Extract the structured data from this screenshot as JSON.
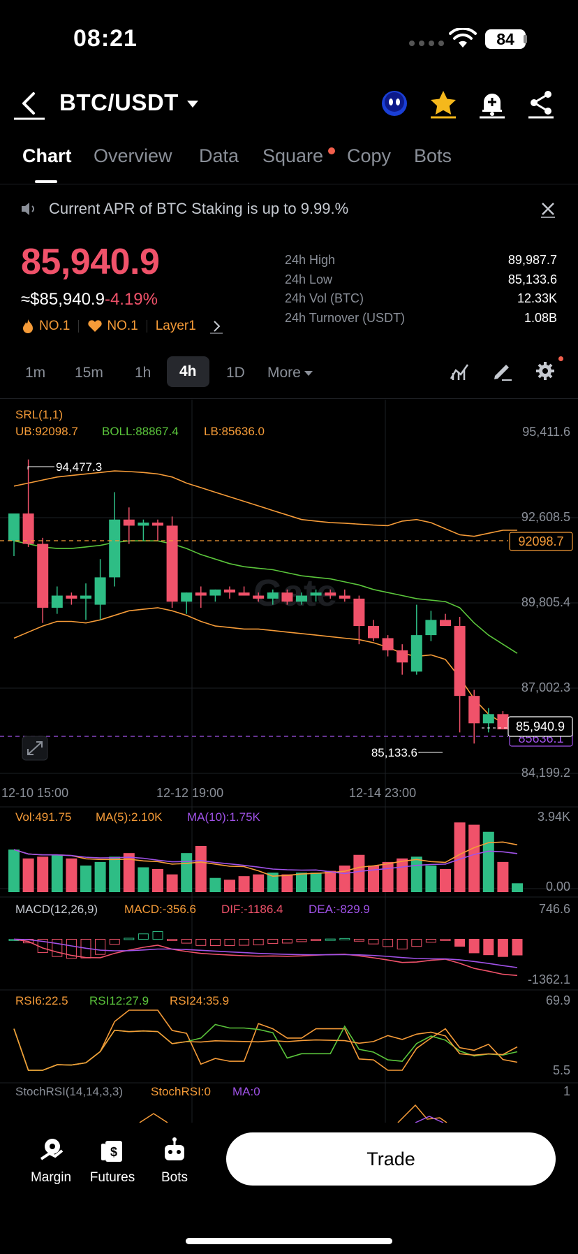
{
  "status": {
    "time": "08:21",
    "battery": "84"
  },
  "header": {
    "pair": "BTC/USDT"
  },
  "tabs": [
    "Chart",
    "Overview",
    "Data",
    "Square",
    "Copy",
    "Bots"
  ],
  "announcement": "Current APR of BTC Staking is up to 9.99.%",
  "price": {
    "last": "85,940.9",
    "usd": "≈$85,940.9",
    "change": "-4.19%",
    "rank1": "NO.1",
    "rank2": "NO.1",
    "tag": "Layer1"
  },
  "stats": [
    {
      "label": "24h High",
      "value": "89,987.7"
    },
    {
      "label": "24h Low",
      "value": "85,133.6"
    },
    {
      "label": "24h Vol (BTC)",
      "value": "12.33K"
    },
    {
      "label": "24h Turnover (USDT)",
      "value": "1.08B"
    }
  ],
  "intervals": {
    "items": [
      "1m",
      "15m",
      "1h",
      "4h",
      "1D"
    ],
    "more": "More",
    "active": "4h"
  },
  "colors": {
    "up": "#2ebd85",
    "down": "#f0526a",
    "upper_band": "#f59b38",
    "mid_band": "#5ac43b",
    "accent": "#f0526a"
  },
  "chart_data": {
    "type": "candlestick",
    "srl_label": "SRL(1,1)",
    "boll": {
      "ub_text": "UB:92098.7",
      "boll_text": "BOLL:88867.4",
      "lb_text": "LB:85636.0"
    },
    "y_ticks": [
      "95,411.6",
      "92,608.5",
      "89,805.4",
      "87,002.3",
      "84,199.2"
    ],
    "x_ticks": [
      "12-10 15:00",
      "12-12 19:00",
      "12-14 23:00"
    ],
    "price_tag_ub": "92098.7",
    "price_tag_last": "85,940.9",
    "price_tag_lb": "85636.1",
    "marker_high": "94,477.3",
    "marker_low": "85,133.6",
    "watermark": "Gate",
    "ylim": [
      84199.2,
      95411.6
    ],
    "candles": [
      {
        "o": 91800,
        "h": 92600,
        "l": 91300,
        "c": 92700
      },
      {
        "o": 92700,
        "h": 94477,
        "l": 91600,
        "c": 91700
      },
      {
        "o": 91700,
        "h": 91900,
        "l": 89100,
        "c": 89600
      },
      {
        "o": 89600,
        "h": 90300,
        "l": 89400,
        "c": 90000
      },
      {
        "o": 90000,
        "h": 90100,
        "l": 89700,
        "c": 89900
      },
      {
        "o": 89900,
        "h": 90400,
        "l": 89200,
        "c": 90000
      },
      {
        "o": 89700,
        "h": 91200,
        "l": 89200,
        "c": 90600
      },
      {
        "o": 90600,
        "h": 93400,
        "l": 90300,
        "c": 92500
      },
      {
        "o": 92500,
        "h": 92900,
        "l": 91700,
        "c": 92300
      },
      {
        "o": 92300,
        "h": 92500,
        "l": 91800,
        "c": 92400
      },
      {
        "o": 92400,
        "h": 92500,
        "l": 91800,
        "c": 92300
      },
      {
        "o": 92300,
        "h": 92600,
        "l": 89600,
        "c": 89800
      },
      {
        "o": 89800,
        "h": 90100,
        "l": 89400,
        "c": 90100
      },
      {
        "o": 90100,
        "h": 90300,
        "l": 89600,
        "c": 90000
      },
      {
        "o": 90000,
        "h": 90200,
        "l": 89800,
        "c": 90200
      },
      {
        "o": 90200,
        "h": 90300,
        "l": 89900,
        "c": 90100
      },
      {
        "o": 90100,
        "h": 90300,
        "l": 90000,
        "c": 90000
      },
      {
        "o": 90000,
        "h": 90100,
        "l": 89800,
        "c": 89900
      },
      {
        "o": 89900,
        "h": 90200,
        "l": 89700,
        "c": 90100
      },
      {
        "o": 90100,
        "h": 90200,
        "l": 89700,
        "c": 89800
      },
      {
        "o": 89800,
        "h": 90100,
        "l": 89700,
        "c": 90000
      },
      {
        "o": 90000,
        "h": 90200,
        "l": 89800,
        "c": 90100
      },
      {
        "o": 90100,
        "h": 90200,
        "l": 89900,
        "c": 90000
      },
      {
        "o": 90000,
        "h": 90200,
        "l": 89800,
        "c": 89900
      },
      {
        "o": 89900,
        "h": 90000,
        "l": 88400,
        "c": 89000
      },
      {
        "o": 89000,
        "h": 89200,
        "l": 88500,
        "c": 88600
      },
      {
        "o": 88600,
        "h": 88700,
        "l": 88000,
        "c": 88200
      },
      {
        "o": 88200,
        "h": 88400,
        "l": 87400,
        "c": 87800
      },
      {
        "o": 87500,
        "h": 89700,
        "l": 87400,
        "c": 88700
      },
      {
        "o": 88700,
        "h": 89500,
        "l": 88500,
        "c": 89200
      },
      {
        "o": 89200,
        "h": 89400,
        "l": 89000,
        "c": 89000
      },
      {
        "o": 89000,
        "h": 89300,
        "l": 85500,
        "c": 86700
      },
      {
        "o": 86700,
        "h": 86900,
        "l": 85133.6,
        "c": 85800
      },
      {
        "o": 85800,
        "h": 86300,
        "l": 85500,
        "c": 86100
      },
      {
        "o": 86100,
        "h": 86200,
        "l": 85600,
        "c": 85600
      },
      {
        "o": 85600,
        "h": 86000,
        "l": 85500,
        "c": 85940.9
      }
    ],
    "boll_upper": [
      93600,
      93700,
      93800,
      93900,
      93950,
      94000,
      94050,
      94100,
      94080,
      94050,
      94000,
      93900,
      93700,
      93550,
      93400,
      93250,
      93100,
      92950,
      92800,
      92650,
      92500,
      92450,
      92400,
      92380,
      92350,
      92320,
      92300,
      92450,
      92500,
      92400,
      92200,
      92000,
      91950,
      92050,
      92150,
      92150
    ],
    "boll_mid": [
      91800,
      91700,
      91600,
      91550,
      91550,
      91600,
      91650,
      91750,
      91800,
      91800,
      91800,
      91700,
      91550,
      91350,
      91200,
      91050,
      90950,
      90900,
      90850,
      90750,
      90650,
      90600,
      90550,
      90450,
      90350,
      90200,
      90100,
      90000,
      89900,
      89850,
      89800,
      89600,
      89100,
      88700,
      88400,
      88100
    ],
    "boll_lower": [
      88600,
      88800,
      89000,
      89150,
      89150,
      89100,
      89200,
      89350,
      89500,
      89550,
      89600,
      89500,
      89350,
      89150,
      89000,
      88950,
      88900,
      88900,
      88850,
      88800,
      88750,
      88700,
      88650,
      88600,
      88550,
      88450,
      88300,
      88100,
      88000,
      88050,
      87900,
      87300,
      86600,
      86100,
      85800,
      85636
    ],
    "volume": {
      "label": "Vol:491.75",
      "ma5_text": "MA(5):2.10K",
      "ma10_text": "MA(10):1.75K",
      "ticks": [
        "3.94K",
        "0.00"
      ],
      "values": [
        2400,
        1900,
        2000,
        2100,
        1900,
        1500,
        1700,
        2000,
        2200,
        1400,
        1300,
        1000,
        2200,
        2600,
        800,
        700,
        900,
        1000,
        1100,
        1000,
        1100,
        1100,
        1200,
        1500,
        2100,
        1500,
        1700,
        1900,
        2000,
        1500,
        1300,
        3930,
        3800,
        3400,
        1700,
        500
      ]
    },
    "macd": {
      "label": "MACD(12,26,9)",
      "macd_text": "MACD:-356.6",
      "dif_text": "DIF:-1186.4",
      "dea_text": "DEA:-829.9",
      "ticks": [
        "746.6",
        "-1362.1"
      ]
    },
    "rsi": {
      "label_6": "RSI6:22.5",
      "label_12": "RSI12:27.9",
      "label_24": "RSI24:35.9",
      "ticks": [
        "69.9",
        "5.5"
      ]
    },
    "stochrsi": {
      "label": "StochRSI(14,14,3,3)",
      "stoch_text": "StochRSI:0",
      "ma_text": "MA:0",
      "tick": "1"
    }
  },
  "bottom_nav": [
    {
      "label": "Margin"
    },
    {
      "label": "Futures"
    },
    {
      "label": "Bots"
    }
  ],
  "trade_label": "Trade"
}
